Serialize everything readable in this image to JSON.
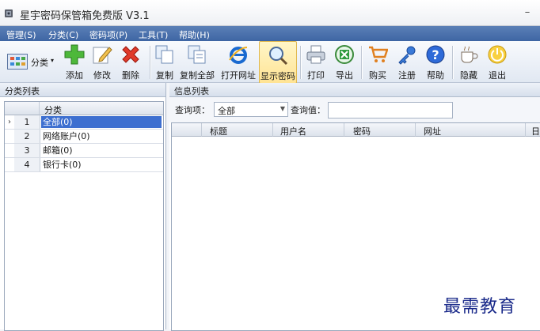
{
  "window": {
    "title": "星宇密码保管箱免费版 V3.1",
    "minimize": "–"
  },
  "menu": {
    "items": [
      "管理(S)",
      "分类(C)",
      "密码项(P)",
      "工具(T)",
      "帮助(H)"
    ]
  },
  "toolbar": {
    "category_dropdown": "分类",
    "add": "添加",
    "edit": "修改",
    "delete": "删除",
    "copy": "复制",
    "copy_all": "复制全部",
    "open_url": "打开网址",
    "show_password": "显示密码",
    "print": "打印",
    "export": "导出",
    "buy": "购买",
    "register": "注册",
    "help": "帮助",
    "hide": "隐藏",
    "exit": "退出"
  },
  "category_panel": {
    "title": "分类列表",
    "column": "分类",
    "rows": [
      {
        "num": "1",
        "name": "全部(0)",
        "selected": true
      },
      {
        "num": "2",
        "name": "网络账户(0)"
      },
      {
        "num": "3",
        "name": "邮箱(0)"
      },
      {
        "num": "4",
        "name": "银行卡(0)"
      }
    ]
  },
  "info_panel": {
    "title": "信息列表",
    "query_item_label": "查询项：",
    "query_item_value": "全部",
    "query_value_label": "查询值：",
    "query_value": "",
    "columns": [
      "标题",
      "用户名",
      "密码",
      "网址",
      "日"
    ]
  },
  "watermark": "最需教育",
  "colors": {
    "menubar": "#4a70ad",
    "selection": "#3d6fd0",
    "toolbar_highlight": "#ffe394"
  }
}
